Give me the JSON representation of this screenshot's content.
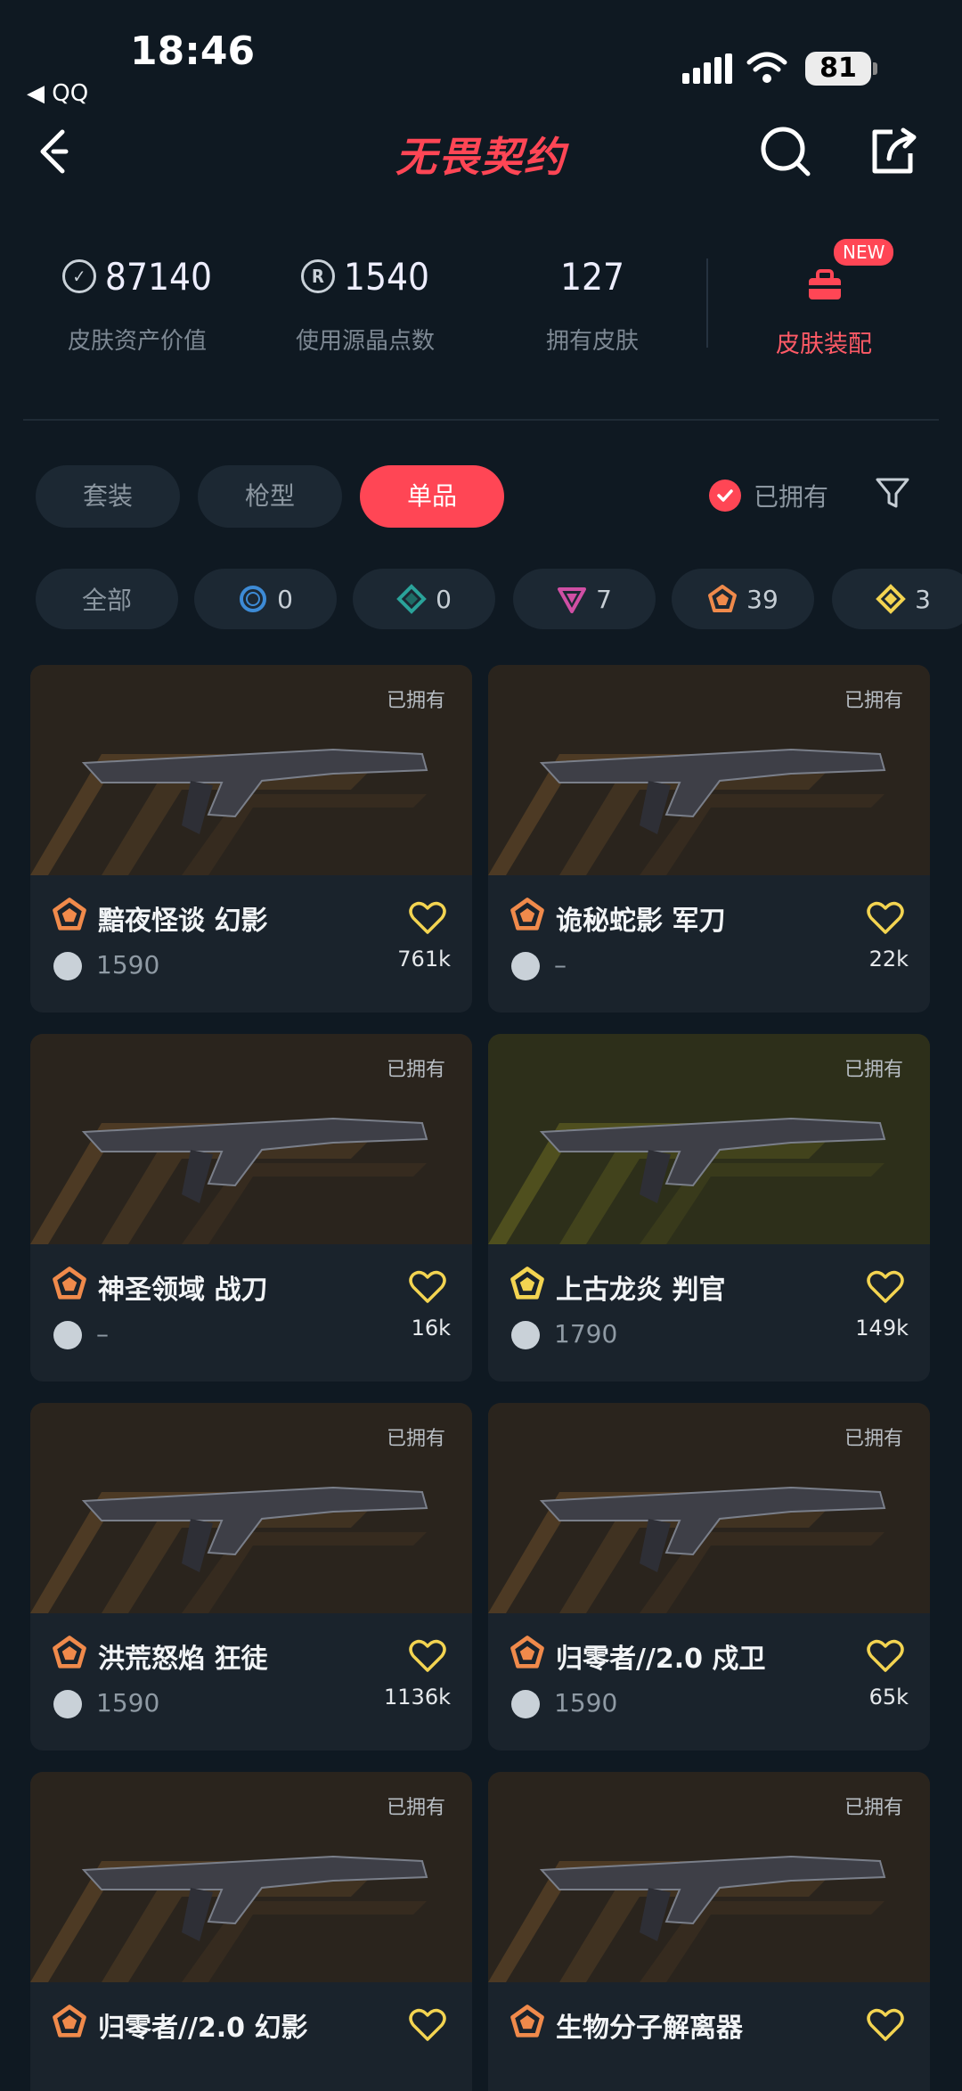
{
  "status_bar": {
    "time": "18:46",
    "back_app": "◀ QQ",
    "battery": "81"
  },
  "header": {
    "logo": "无畏契约"
  },
  "stats": [
    {
      "value": "87140",
      "label": "皮肤资产价值",
      "icon": "vp-icon"
    },
    {
      "value": "1540",
      "label": "使用源晶点数",
      "icon": "radianite-icon"
    },
    {
      "value": "127",
      "label": "拥有皮肤",
      "icon": ""
    }
  ],
  "equip": {
    "badge": "NEW",
    "label": "皮肤装配"
  },
  "tabs": [
    {
      "label": "套装"
    },
    {
      "label": "枪型"
    },
    {
      "label": "单品",
      "active": true
    }
  ],
  "owned_filter": {
    "label": "已拥有",
    "checked": true
  },
  "tiers": [
    {
      "label": "全部",
      "count": ""
    },
    {
      "icon": "select-tier-icon",
      "count": "0",
      "color": "#3d8bd6"
    },
    {
      "icon": "deluxe-tier-icon",
      "count": "0",
      "color": "#2aa39a"
    },
    {
      "icon": "premium-tier-icon",
      "count": "7",
      "color": "#d04fa4"
    },
    {
      "icon": "exclusive-tier-icon",
      "count": "39",
      "color": "#f08a4b"
    },
    {
      "icon": "ultra-tier-icon",
      "count": "3",
      "color": "#f3d451"
    }
  ],
  "cards": [
    {
      "owned": "已拥有",
      "name": "黯夜怪谈 幻影",
      "price": "1590",
      "likes": "761k",
      "tier_color": "#f08a4b"
    },
    {
      "owned": "已拥有",
      "name": "诡秘蛇影 军刀",
      "price": "–",
      "likes": "22k",
      "tier_color": "#f08a4b"
    },
    {
      "owned": "已拥有",
      "name": "神圣领域 战刀",
      "price": "–",
      "likes": "16k",
      "tier_color": "#f08a4b"
    },
    {
      "owned": "已拥有",
      "name": "上古龙炎 判官",
      "price": "1790",
      "likes": "149k",
      "tier_color": "#f3d451"
    },
    {
      "owned": "已拥有",
      "name": "洪荒怒焰 狂徒",
      "price": "1590",
      "likes": "1136k",
      "tier_color": "#f08a4b"
    },
    {
      "owned": "已拥有",
      "name": "归零者//2.0 戍卫",
      "price": "1590",
      "likes": "65k",
      "tier_color": "#f08a4b"
    },
    {
      "owned": "已拥有",
      "name": "归零者//2.0 幻影",
      "price": "",
      "likes": "",
      "tier_color": "#f08a4b"
    },
    {
      "owned": "已拥有",
      "name": "生物分子解离器",
      "price": "",
      "likes": "",
      "tier_color": "#f08a4b"
    }
  ],
  "colors": {
    "accent": "#ff4655",
    "background": "#0f1922"
  }
}
